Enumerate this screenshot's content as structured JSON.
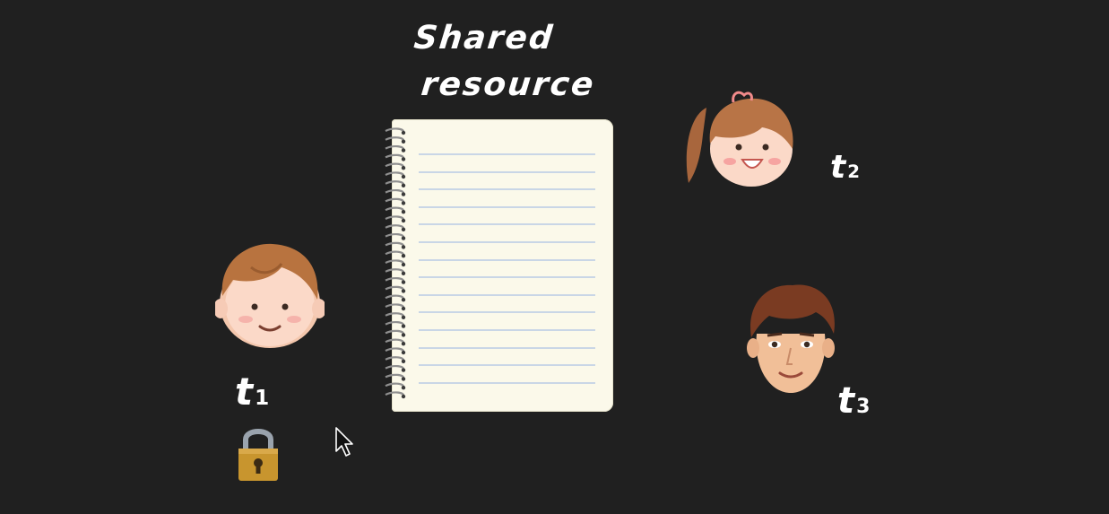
{
  "slide": {
    "background_color": "#202020",
    "title_line1": "Shared",
    "title_line2": "resource",
    "threads": [
      {
        "base": "t",
        "sub": "1"
      },
      {
        "base": "t",
        "sub": "2"
      },
      {
        "base": "t",
        "sub": "3"
      }
    ]
  },
  "icons": {
    "notebook": "spiral-notebook-icon",
    "boy": "boy-face-icon",
    "girl": "girl-face-icon",
    "man": "man-face-icon",
    "lock": "padlock-icon",
    "cursor": "mouse-pointer-icon"
  },
  "colors": {
    "text": "#ffffff",
    "paper": "#fbf9ea",
    "rule_lines": "#c9d6e6",
    "lock_body": "#c8952e"
  }
}
